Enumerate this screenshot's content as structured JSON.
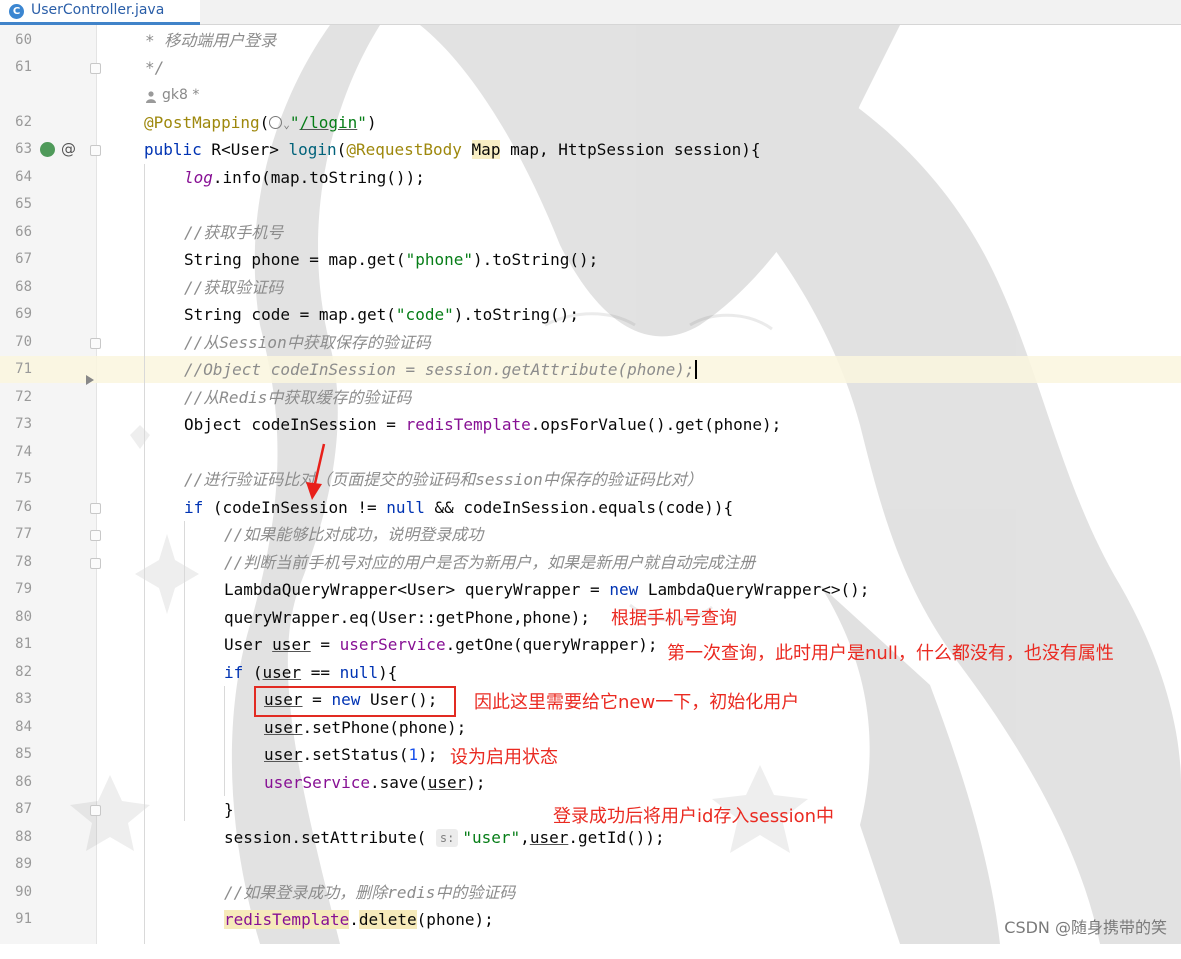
{
  "tab": {
    "icon_letter": "C",
    "title": "UserController.java"
  },
  "author_hint": "gk8 *",
  "inline_hint": "s:",
  "annotations": {
    "query_by_phone": "根据手机号查询",
    "first_query": "第一次查询，此时用户是null，什么都没有，也没有属性",
    "new_user": "因此这里需要给它new一下，初始化用户",
    "enable_status": "设为启用状态",
    "store_session": "登录成功后将用户id存入session中"
  },
  "watermark": "CSDN @随身携带的笑",
  "colors": {
    "annotation_red": "#ea2a21",
    "keyword": "#0033b3",
    "string": "#067d17",
    "comment": "#8c8c8c"
  },
  "icons": [
    "java-class-icon",
    "person-icon",
    "globe-icon",
    "run-gutter-icon",
    "at-icon",
    "fold-marker-icon",
    "breakpoint-arrow-icon",
    "arrow-pointer-icon"
  ],
  "lines": [
    {
      "n": "60",
      "t": "* 移动端用户登录"
    },
    {
      "n": "61",
      "t": "*/"
    },
    {
      "n": "",
      "t": "gk8 *"
    },
    {
      "n": "62",
      "t": "@PostMapping(\"/login\")"
    },
    {
      "n": "63",
      "t": "public R<User> login(@RequestBody Map map, HttpSession session){"
    },
    {
      "n": "64",
      "t": "log.info(map.toString());"
    },
    {
      "n": "65",
      "t": ""
    },
    {
      "n": "66",
      "t": "//获取手机号"
    },
    {
      "n": "67",
      "t": "String phone = map.get(\"phone\").toString();"
    },
    {
      "n": "68",
      "t": "//获取验证码"
    },
    {
      "n": "69",
      "t": "String code = map.get(\"code\").toString();"
    },
    {
      "n": "70",
      "t": "//从Session中获取保存的验证码"
    },
    {
      "n": "71",
      "t": "//Object codeInSession = session.getAttribute(phone);"
    },
    {
      "n": "72",
      "t": "//从Redis中获取缓存的验证码"
    },
    {
      "n": "73",
      "t": "Object codeInSession = redisTemplate.opsForValue().get(phone);"
    },
    {
      "n": "74",
      "t": ""
    },
    {
      "n": "75",
      "t": "//进行验证码比对（页面提交的验证码和session中保存的验证码比对）"
    },
    {
      "n": "76",
      "t": "if (codeInSession != null && codeInSession.equals(code)){"
    },
    {
      "n": "77",
      "t": "//如果能够比对成功，说明登录成功"
    },
    {
      "n": "78",
      "t": "//判断当前手机号对应的用户是否为新用户，如果是新用户就自动完成注册"
    },
    {
      "n": "79",
      "t": "LambdaQueryWrapper<User> queryWrapper = new LambdaQueryWrapper<>();"
    },
    {
      "n": "80",
      "t": "queryWrapper.eq(User::getPhone,phone);"
    },
    {
      "n": "81",
      "t": "User user = userService.getOne(queryWrapper);"
    },
    {
      "n": "82",
      "t": "if (user == null){"
    },
    {
      "n": "83",
      "t": "user = new User();"
    },
    {
      "n": "84",
      "t": "user.setPhone(phone);"
    },
    {
      "n": "85",
      "t": "user.setStatus(1);"
    },
    {
      "n": "86",
      "t": "userService.save(user);"
    },
    {
      "n": "87",
      "t": "}"
    },
    {
      "n": "88",
      "t": "session.setAttribute( s: \"user\",user.getId());"
    },
    {
      "n": "89",
      "t": ""
    },
    {
      "n": "90",
      "t": "//如果登录成功，删除redis中的验证码"
    },
    {
      "n": "91",
      "t": "redisTemplate.delete(phone);"
    }
  ]
}
